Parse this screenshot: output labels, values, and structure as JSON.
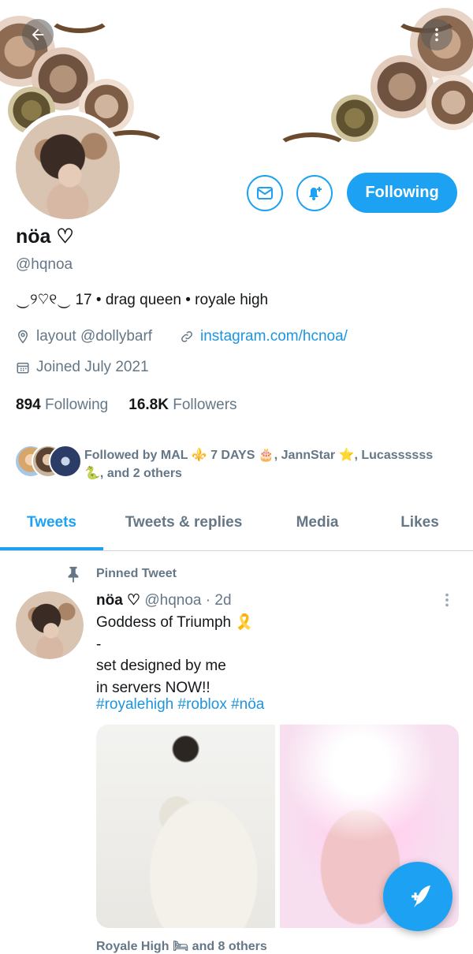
{
  "header": {
    "back_icon": "arrow-left-icon",
    "more_icon": "vertical-dots-icon"
  },
  "profile": {
    "name": "nöa ♡",
    "handle": "@hqnoa",
    "bio": "‿୨♡୧‿ 17 • drag queen • royale high",
    "location": "layout @dollybarf",
    "website": "instagram.com/hcnoa/",
    "joined": "Joined July 2021",
    "following_count": "894",
    "following_label": "Following",
    "followers_count": "16.8K",
    "followers_label": "Followers"
  },
  "actions": {
    "follow_label": "Following",
    "message_icon": "envelope-icon",
    "notify_icon": "bell-plus-icon"
  },
  "followed_by": {
    "line1": "Followed by MAL ⚜️ 7 DAYS 🎂, JannStar ⭐, Lucassssss",
    "line2": "🐍, and 2 others"
  },
  "tabs": [
    {
      "label": "Tweets",
      "active": true
    },
    {
      "label": "Tweets & replies",
      "active": false
    },
    {
      "label": "Media",
      "active": false
    },
    {
      "label": "Likes",
      "active": false
    }
  ],
  "tweet": {
    "pinned_label": "Pinned Tweet",
    "author_name": "nöa ♡",
    "author_handle": "@hqnoa",
    "time": "· 2d",
    "text": "Goddess of Triumph 🎗️\n-\nset designed by me\nin servers NOW!!",
    "hashtags": "#royalehigh #roblox #nöa",
    "footer_partial": "Royale High 🛏 and 8 others"
  },
  "colors": {
    "accent": "#1da1f2",
    "link": "#1b95e0",
    "muted": "#657786"
  }
}
